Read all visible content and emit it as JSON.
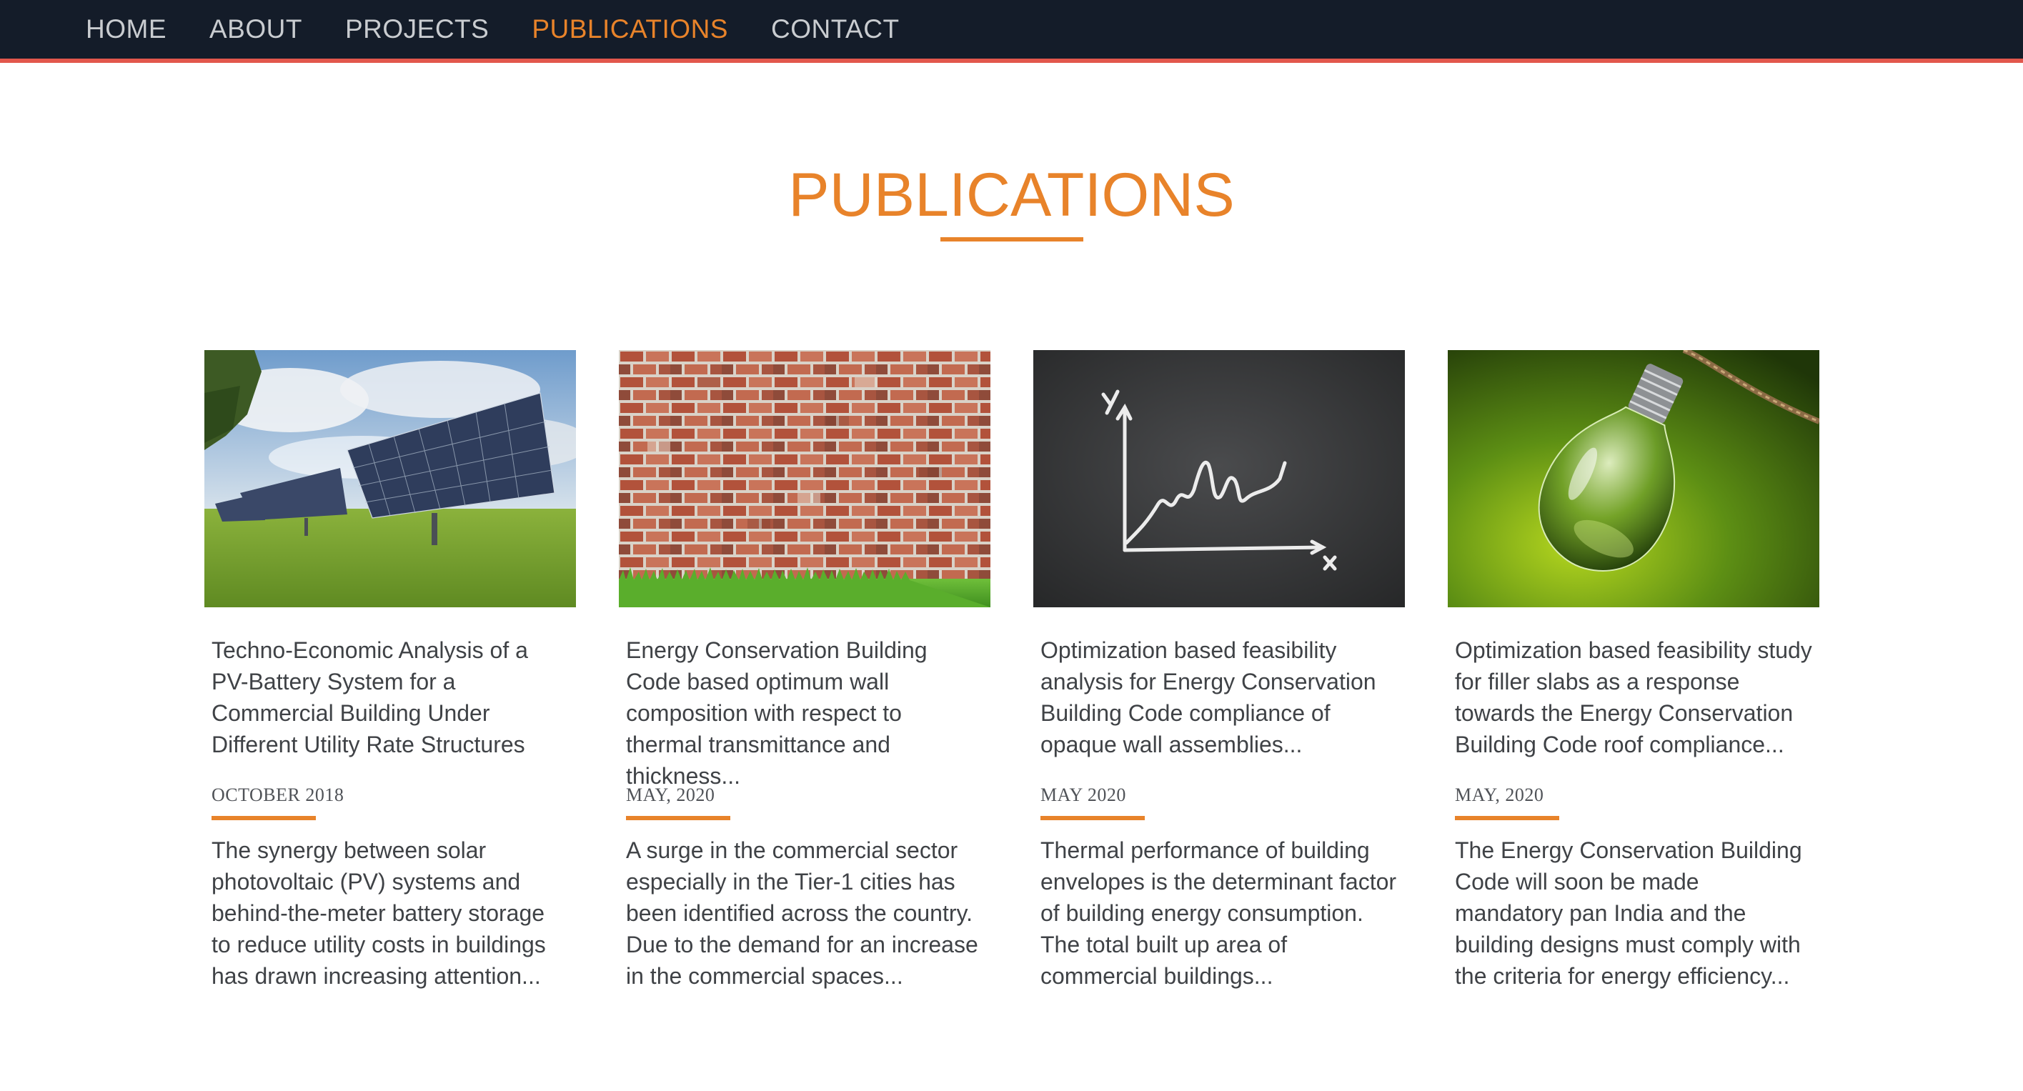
{
  "nav": {
    "items": [
      {
        "label": "HOME"
      },
      {
        "label": "ABOUT"
      },
      {
        "label": "PROJECTS"
      },
      {
        "label": "PUBLICATIONS",
        "active": true
      },
      {
        "label": "CONTACT"
      }
    ]
  },
  "section": {
    "title": "PUBLICATIONS"
  },
  "publications": [
    {
      "image": "solar-panels-field",
      "title": "Techno-Economic Analysis of a PV-Battery System for a Commercial Building Under Different Utility Rate Structures",
      "date": "OCTOBER 2018",
      "excerpt": "The synergy between solar photovoltaic (PV) systems and behind-the-meter battery storage to reduce utility costs in buildings has drawn increasing attention..."
    },
    {
      "image": "brick-wall-on-grass",
      "title": "Energy Conservation Building Code based optimum wall composition with respect to thermal transmittance and thickness...",
      "date": "MAY, 2020",
      "excerpt": "A surge in the commercial sector especially in the Tier-1 cities has been identified across the country. Due to the demand for an increase in the commercial spaces..."
    },
    {
      "image": "chalkboard-graph",
      "title": "Optimization based feasibility analysis for Energy Conservation Building Code compliance of opaque wall assemblies...",
      "date": "MAY 2020",
      "excerpt": "Thermal performance of building envelopes is the determinant factor of building energy consumption. The total built up area of commercial buildings..."
    },
    {
      "image": "light-bulb-green",
      "title": "Optimization based feasibility study for filler slabs as a response towards the Energy Conservation Building Code roof compliance...",
      "date": "MAY, 2020",
      "excerpt": "The Energy Conservation Building Code will soon be made mandatory pan India and the building designs must comply with the criteria for energy efficiency..."
    }
  ],
  "colors": {
    "navbar_bg": "#141c29",
    "navbar_border": "#e2574c",
    "accent": "#e8832a",
    "nav_text": "#c9ccd0",
    "body_text": "#3f4246"
  }
}
